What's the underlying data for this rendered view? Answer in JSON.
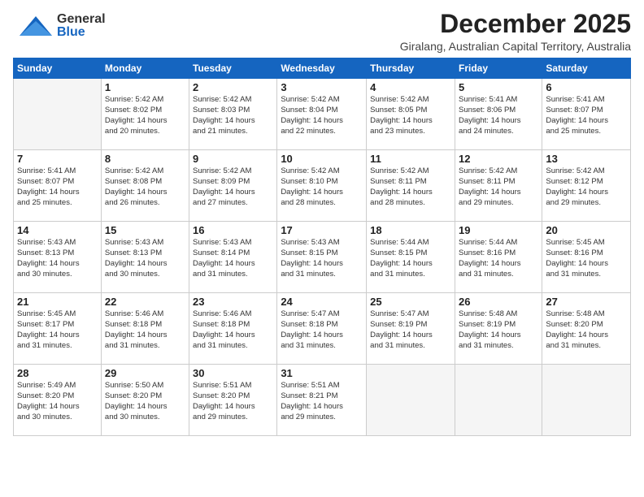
{
  "header": {
    "logo_general": "General",
    "logo_blue": "Blue",
    "month_title": "December 2025",
    "subtitle": "Giralang, Australian Capital Territory, Australia"
  },
  "columns": [
    "Sunday",
    "Monday",
    "Tuesday",
    "Wednesday",
    "Thursday",
    "Friday",
    "Saturday"
  ],
  "weeks": [
    [
      {
        "day": "",
        "info": ""
      },
      {
        "day": "1",
        "info": "Sunrise: 5:42 AM\nSunset: 8:02 PM\nDaylight: 14 hours\nand 20 minutes."
      },
      {
        "day": "2",
        "info": "Sunrise: 5:42 AM\nSunset: 8:03 PM\nDaylight: 14 hours\nand 21 minutes."
      },
      {
        "day": "3",
        "info": "Sunrise: 5:42 AM\nSunset: 8:04 PM\nDaylight: 14 hours\nand 22 minutes."
      },
      {
        "day": "4",
        "info": "Sunrise: 5:42 AM\nSunset: 8:05 PM\nDaylight: 14 hours\nand 23 minutes."
      },
      {
        "day": "5",
        "info": "Sunrise: 5:41 AM\nSunset: 8:06 PM\nDaylight: 14 hours\nand 24 minutes."
      },
      {
        "day": "6",
        "info": "Sunrise: 5:41 AM\nSunset: 8:07 PM\nDaylight: 14 hours\nand 25 minutes."
      }
    ],
    [
      {
        "day": "7",
        "info": "Sunrise: 5:41 AM\nSunset: 8:07 PM\nDaylight: 14 hours\nand 25 minutes."
      },
      {
        "day": "8",
        "info": "Sunrise: 5:42 AM\nSunset: 8:08 PM\nDaylight: 14 hours\nand 26 minutes."
      },
      {
        "day": "9",
        "info": "Sunrise: 5:42 AM\nSunset: 8:09 PM\nDaylight: 14 hours\nand 27 minutes."
      },
      {
        "day": "10",
        "info": "Sunrise: 5:42 AM\nSunset: 8:10 PM\nDaylight: 14 hours\nand 28 minutes."
      },
      {
        "day": "11",
        "info": "Sunrise: 5:42 AM\nSunset: 8:11 PM\nDaylight: 14 hours\nand 28 minutes."
      },
      {
        "day": "12",
        "info": "Sunrise: 5:42 AM\nSunset: 8:11 PM\nDaylight: 14 hours\nand 29 minutes."
      },
      {
        "day": "13",
        "info": "Sunrise: 5:42 AM\nSunset: 8:12 PM\nDaylight: 14 hours\nand 29 minutes."
      }
    ],
    [
      {
        "day": "14",
        "info": "Sunrise: 5:43 AM\nSunset: 8:13 PM\nDaylight: 14 hours\nand 30 minutes."
      },
      {
        "day": "15",
        "info": "Sunrise: 5:43 AM\nSunset: 8:13 PM\nDaylight: 14 hours\nand 30 minutes."
      },
      {
        "day": "16",
        "info": "Sunrise: 5:43 AM\nSunset: 8:14 PM\nDaylight: 14 hours\nand 31 minutes."
      },
      {
        "day": "17",
        "info": "Sunrise: 5:43 AM\nSunset: 8:15 PM\nDaylight: 14 hours\nand 31 minutes."
      },
      {
        "day": "18",
        "info": "Sunrise: 5:44 AM\nSunset: 8:15 PM\nDaylight: 14 hours\nand 31 minutes."
      },
      {
        "day": "19",
        "info": "Sunrise: 5:44 AM\nSunset: 8:16 PM\nDaylight: 14 hours\nand 31 minutes."
      },
      {
        "day": "20",
        "info": "Sunrise: 5:45 AM\nSunset: 8:16 PM\nDaylight: 14 hours\nand 31 minutes."
      }
    ],
    [
      {
        "day": "21",
        "info": "Sunrise: 5:45 AM\nSunset: 8:17 PM\nDaylight: 14 hours\nand 31 minutes."
      },
      {
        "day": "22",
        "info": "Sunrise: 5:46 AM\nSunset: 8:18 PM\nDaylight: 14 hours\nand 31 minutes."
      },
      {
        "day": "23",
        "info": "Sunrise: 5:46 AM\nSunset: 8:18 PM\nDaylight: 14 hours\nand 31 minutes."
      },
      {
        "day": "24",
        "info": "Sunrise: 5:47 AM\nSunset: 8:18 PM\nDaylight: 14 hours\nand 31 minutes."
      },
      {
        "day": "25",
        "info": "Sunrise: 5:47 AM\nSunset: 8:19 PM\nDaylight: 14 hours\nand 31 minutes."
      },
      {
        "day": "26",
        "info": "Sunrise: 5:48 AM\nSunset: 8:19 PM\nDaylight: 14 hours\nand 31 minutes."
      },
      {
        "day": "27",
        "info": "Sunrise: 5:48 AM\nSunset: 8:20 PM\nDaylight: 14 hours\nand 31 minutes."
      }
    ],
    [
      {
        "day": "28",
        "info": "Sunrise: 5:49 AM\nSunset: 8:20 PM\nDaylight: 14 hours\nand 30 minutes."
      },
      {
        "day": "29",
        "info": "Sunrise: 5:50 AM\nSunset: 8:20 PM\nDaylight: 14 hours\nand 30 minutes."
      },
      {
        "day": "30",
        "info": "Sunrise: 5:51 AM\nSunset: 8:20 PM\nDaylight: 14 hours\nand 29 minutes."
      },
      {
        "day": "31",
        "info": "Sunrise: 5:51 AM\nSunset: 8:21 PM\nDaylight: 14 hours\nand 29 minutes."
      },
      {
        "day": "",
        "info": ""
      },
      {
        "day": "",
        "info": ""
      },
      {
        "day": "",
        "info": ""
      }
    ]
  ]
}
